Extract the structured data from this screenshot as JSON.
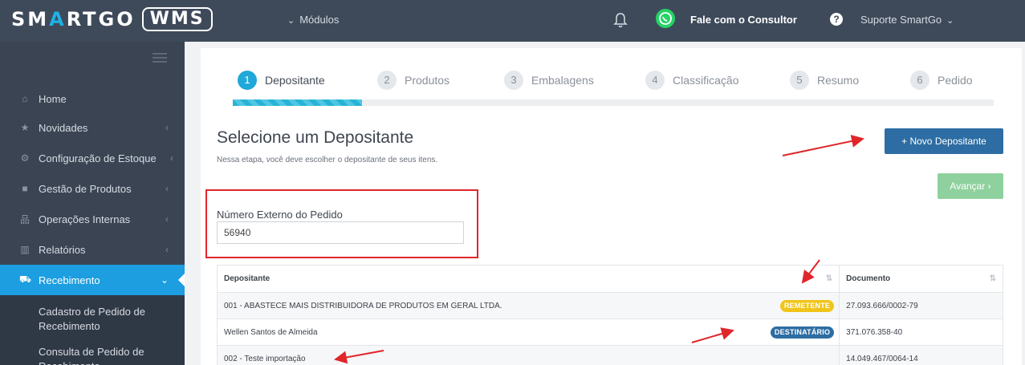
{
  "topbar": {
    "logo_left_a": "SM",
    "logo_left_accent": "A",
    "logo_left_b": "RTGO",
    "logo_box": "WMS",
    "modules_label": "Módulos",
    "consultant_label": "Fale com o Consultor",
    "support_label": "Suporte SmartGo",
    "whatsapp_color": "#25d366"
  },
  "sidebar": {
    "items": [
      {
        "label": "Home",
        "icon": "home-icon",
        "glyph": "⌂",
        "has_arrow": false
      },
      {
        "label": "Novidades",
        "icon": "star-icon",
        "glyph": "★",
        "has_arrow": true
      },
      {
        "label": "Configuração de Estoque",
        "icon": "cogs-icon",
        "glyph": "⚙",
        "has_arrow": true
      },
      {
        "label": "Gestão de Produtos",
        "icon": "box-icon",
        "glyph": "■",
        "has_arrow": true
      },
      {
        "label": "Operações Internas",
        "icon": "sitemap-icon",
        "glyph": "品",
        "has_arrow": true
      },
      {
        "label": "Relatórios",
        "icon": "bar-chart-icon",
        "glyph": "▥",
        "has_arrow": true
      },
      {
        "label": "Recebimento",
        "icon": "truck-icon",
        "glyph": "⛟",
        "has_arrow": true,
        "active": true
      }
    ],
    "subitems": [
      {
        "label": "Cadastro de Pedido de Recebimento"
      },
      {
        "label": "Consulta de Pedido de Recebimento"
      }
    ],
    "active_color": "#1c9ee0"
  },
  "wizard": {
    "steps": [
      {
        "num": "1",
        "label": "Depositante",
        "active": true
      },
      {
        "num": "2",
        "label": "Produtos"
      },
      {
        "num": "3",
        "label": "Embalagens"
      },
      {
        "num": "4",
        "label": "Classificação"
      },
      {
        "num": "5",
        "label": "Resumo"
      },
      {
        "num": "6",
        "label": "Pedido"
      }
    ],
    "progress_fraction": 0.17
  },
  "main": {
    "title": "Selecione um Depositante",
    "subtitle": "Nessa etapa, você deve escolher o depositante de seus itens.",
    "new_button": "+ Novo Depositante",
    "next_button": "Avançar ›",
    "field_label": "Número Externo do Pedido",
    "field_value": "56940"
  },
  "table": {
    "headers": [
      "Depositante",
      "Documento"
    ],
    "rows": [
      {
        "depositante": "001 - ABASTECE MAIS DISTRIBUIDORA DE PRODUTOS EM GERAL LTDA.",
        "badge": "REMETENTE",
        "documento": "27.093.666/0002-79"
      },
      {
        "depositante": "Wellen Santos de Almeida",
        "badge": "DESTINATÁRIO",
        "documento": "371.076.358-40"
      },
      {
        "depositante": "002 - Teste importação",
        "badge": "",
        "documento": "14.049.467/0064-14"
      }
    ]
  },
  "annotations": {
    "highlight_color": "#e0262b"
  }
}
